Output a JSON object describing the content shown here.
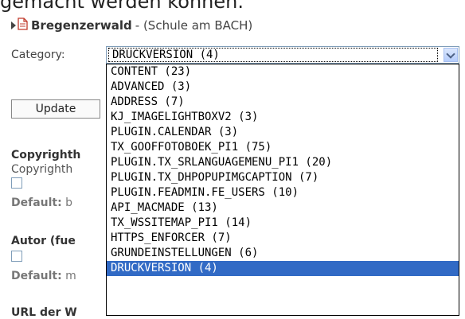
{
  "page": {
    "top_text": "gemacht werden können."
  },
  "header": {
    "title_strong": "Bregenzerwald",
    "title_rest": "- (Schule am BACH)"
  },
  "category": {
    "label": "Category:",
    "selected": "DRUCKVERSION (4)",
    "options": [
      "CONTENT (23)",
      "ADVANCED (3)",
      "ADDRESS (7)",
      "KJ_IMAGELIGHTBOXV2 (3)",
      "PLUGIN.CALENDAR (3)",
      "TX_GOOFFOTOBOEK_PI1 (75)",
      "PLUGIN.TX_SRLANGUAGEMENU_PI1 (20)",
      "PLUGIN.TX_DHPOPUPIMGCAPTION (7)",
      "PLUGIN.FEADMIN.FE_USERS (10)",
      "API_MACMADE (13)",
      "TX_WSSITEMAP_PI1 (14)",
      "HTTPS_ENFORCER (7)",
      "GRUNDEINSTELLUNGEN (6)",
      "DRUCKVERSION (4)"
    ]
  },
  "form": {
    "update_label": "Update",
    "field1_title": "Copyrighth",
    "field1_text": "Copyrighth",
    "field1_default_label": "Default:",
    "field1_default_value": "b",
    "field2_title": "Autor (fue",
    "field2_default_label": "Default:",
    "field2_default_value": "m",
    "field3_title": "URL der W"
  },
  "colors": {
    "selection": "#316ac5",
    "select_border": "#7f9db9"
  }
}
